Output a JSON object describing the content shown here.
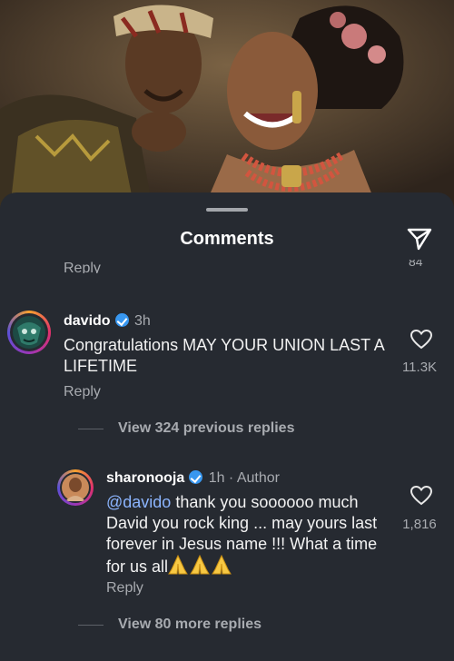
{
  "header": {
    "title": "Comments"
  },
  "clipped_above": {
    "reply_label": "Reply",
    "likes": "84"
  },
  "comment": {
    "username": "davido",
    "time": "3h",
    "text": "Congratulations MAY YOUR UNION LAST A LIFETIME",
    "reply_label": "Reply",
    "likes": "11.3K",
    "view_replies": "View 324 previous replies"
  },
  "reply": {
    "username": "sharonooja",
    "meta": "1h · Author",
    "mention": "@davido",
    "text": " thank you soooooo much David you rock king ... may yours last forever in Jesus name !!! What a time for us all",
    "reply_label": "Reply",
    "likes": "1,816",
    "view_replies": "View 80 more replies"
  },
  "colors": {
    "sheet_background": "#262a31",
    "verified_badge": "#3897f0",
    "mention": "#8cb5ff",
    "secondary_text": "#a8abb0",
    "story_ring": [
      "#f9a12e",
      "#e1306c",
      "#9b36b7",
      "#5b51d8"
    ],
    "emoji": "#f7c843"
  },
  "icons": {
    "send": "paper-plane-icon",
    "like": "heart-icon",
    "verified": "verified-badge-icon",
    "emoji": "folded-hands-emoji"
  }
}
